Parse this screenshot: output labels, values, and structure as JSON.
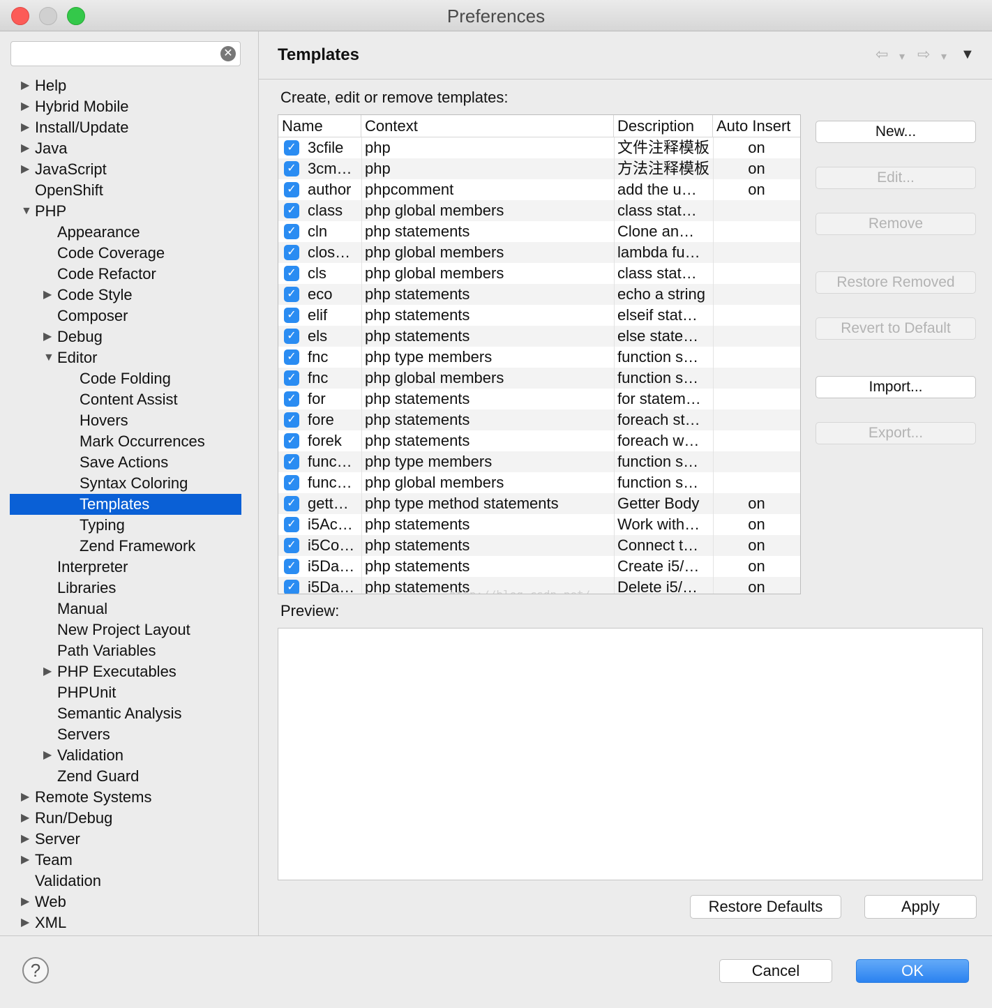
{
  "window": {
    "title": "Preferences"
  },
  "search": {
    "placeholder": "",
    "value": ""
  },
  "tree": [
    {
      "label": "Help",
      "level": 0,
      "expander": "collapsed"
    },
    {
      "label": "Hybrid Mobile",
      "level": 0,
      "expander": "collapsed"
    },
    {
      "label": "Install/Update",
      "level": 0,
      "expander": "collapsed"
    },
    {
      "label": "Java",
      "level": 0,
      "expander": "collapsed"
    },
    {
      "label": "JavaScript",
      "level": 0,
      "expander": "collapsed"
    },
    {
      "label": "OpenShift",
      "level": 0,
      "expander": "none"
    },
    {
      "label": "PHP",
      "level": 0,
      "expander": "expanded"
    },
    {
      "label": "Appearance",
      "level": 1,
      "expander": "none"
    },
    {
      "label": "Code Coverage",
      "level": 1,
      "expander": "none"
    },
    {
      "label": "Code Refactor",
      "level": 1,
      "expander": "none"
    },
    {
      "label": "Code Style",
      "level": 1,
      "expander": "collapsed"
    },
    {
      "label": "Composer",
      "level": 1,
      "expander": "none"
    },
    {
      "label": "Debug",
      "level": 1,
      "expander": "collapsed"
    },
    {
      "label": "Editor",
      "level": 1,
      "expander": "expanded"
    },
    {
      "label": "Code Folding",
      "level": 2,
      "expander": "none"
    },
    {
      "label": "Content Assist",
      "level": 2,
      "expander": "none"
    },
    {
      "label": "Hovers",
      "level": 2,
      "expander": "none"
    },
    {
      "label": "Mark Occurrences",
      "level": 2,
      "expander": "none"
    },
    {
      "label": "Save Actions",
      "level": 2,
      "expander": "none"
    },
    {
      "label": "Syntax Coloring",
      "level": 2,
      "expander": "none"
    },
    {
      "label": "Templates",
      "level": 2,
      "expander": "none",
      "selected": true
    },
    {
      "label": "Typing",
      "level": 2,
      "expander": "none"
    },
    {
      "label": "Zend Framework",
      "level": 2,
      "expander": "none"
    },
    {
      "label": "Interpreter",
      "level": 1,
      "expander": "none"
    },
    {
      "label": "Libraries",
      "level": 1,
      "expander": "none"
    },
    {
      "label": "Manual",
      "level": 1,
      "expander": "none"
    },
    {
      "label": "New Project Layout",
      "level": 1,
      "expander": "none"
    },
    {
      "label": "Path Variables",
      "level": 1,
      "expander": "none"
    },
    {
      "label": "PHP Executables",
      "level": 1,
      "expander": "collapsed"
    },
    {
      "label": "PHPUnit",
      "level": 1,
      "expander": "none"
    },
    {
      "label": "Semantic Analysis",
      "level": 1,
      "expander": "none"
    },
    {
      "label": "Servers",
      "level": 1,
      "expander": "none"
    },
    {
      "label": "Validation",
      "level": 1,
      "expander": "collapsed"
    },
    {
      "label": "Zend Guard",
      "level": 1,
      "expander": "none"
    },
    {
      "label": "Remote Systems",
      "level": 0,
      "expander": "collapsed"
    },
    {
      "label": "Run/Debug",
      "level": 0,
      "expander": "collapsed"
    },
    {
      "label": "Server",
      "level": 0,
      "expander": "collapsed"
    },
    {
      "label": "Team",
      "level": 0,
      "expander": "collapsed"
    },
    {
      "label": "Validation",
      "level": 0,
      "expander": "none"
    },
    {
      "label": "Web",
      "level": 0,
      "expander": "collapsed"
    },
    {
      "label": "XML",
      "level": 0,
      "expander": "collapsed"
    }
  ],
  "page": {
    "title": "Templates",
    "intro": "Create, edit or remove templates:",
    "preview_label": "Preview:",
    "watermark": "http://blog.csdn.net/"
  },
  "table": {
    "columns": [
      "Name",
      "Context",
      "Description",
      "Auto Insert"
    ],
    "rows": [
      {
        "name": "3cfile",
        "context": "php",
        "description": "文件注释模板",
        "auto": "on",
        "checked": true
      },
      {
        "name": "3cm…",
        "context": "php",
        "description": "方法注释模板",
        "auto": "on",
        "checked": true
      },
      {
        "name": "author",
        "context": "phpcomment",
        "description": "add the u…",
        "auto": "on",
        "checked": true
      },
      {
        "name": "class",
        "context": "php global members",
        "description": "class stat…",
        "auto": "",
        "checked": true
      },
      {
        "name": "cln",
        "context": "php statements",
        "description": "Clone an…",
        "auto": "",
        "checked": true
      },
      {
        "name": "clos…",
        "context": "php global members",
        "description": "lambda fu…",
        "auto": "",
        "checked": true
      },
      {
        "name": "cls",
        "context": "php global members",
        "description": "class stat…",
        "auto": "",
        "checked": true
      },
      {
        "name": "eco",
        "context": "php statements",
        "description": "echo a string",
        "auto": "",
        "checked": true
      },
      {
        "name": "elif",
        "context": "php statements",
        "description": "elseif stat…",
        "auto": "",
        "checked": true
      },
      {
        "name": "els",
        "context": "php statements",
        "description": "else state…",
        "auto": "",
        "checked": true
      },
      {
        "name": "fnc",
        "context": "php type members",
        "description": "function s…",
        "auto": "",
        "checked": true
      },
      {
        "name": "fnc",
        "context": "php global members",
        "description": "function s…",
        "auto": "",
        "checked": true
      },
      {
        "name": "for",
        "context": "php statements",
        "description": "for statem…",
        "auto": "",
        "checked": true
      },
      {
        "name": "fore",
        "context": "php statements",
        "description": "foreach st…",
        "auto": "",
        "checked": true
      },
      {
        "name": "forek",
        "context": "php statements",
        "description": "foreach w…",
        "auto": "",
        "checked": true
      },
      {
        "name": "func…",
        "context": "php type members",
        "description": "function s…",
        "auto": "",
        "checked": true
      },
      {
        "name": "func…",
        "context": "php global members",
        "description": "function s…",
        "auto": "",
        "checked": true
      },
      {
        "name": "gett…",
        "context": "php type method statements",
        "description": "Getter Body",
        "auto": "on",
        "checked": true
      },
      {
        "name": "i5Ac…",
        "context": "php statements",
        "description": "Work with…",
        "auto": "on",
        "checked": true
      },
      {
        "name": "i5Co…",
        "context": "php statements",
        "description": "Connect t…",
        "auto": "on",
        "checked": true
      },
      {
        "name": "i5Da…",
        "context": "php statements",
        "description": "Create i5/…",
        "auto": "on",
        "checked": true
      },
      {
        "name": "i5Da…",
        "context": "php statements",
        "description": "Delete i5/…",
        "auto": "on",
        "checked": true
      }
    ]
  },
  "side_buttons": [
    {
      "label": "New...",
      "enabled": true
    },
    {
      "label": "Edit...",
      "enabled": false
    },
    {
      "label": "Remove",
      "enabled": false
    },
    {
      "label": "Restore Removed",
      "enabled": false
    },
    {
      "label": "Revert to Default",
      "enabled": false
    },
    {
      "label": "Import...",
      "enabled": true
    },
    {
      "label": "Export...",
      "enabled": false
    }
  ],
  "bottom": {
    "restore_defaults": "Restore Defaults",
    "apply": "Apply"
  },
  "footer": {
    "help": "?",
    "cancel": "Cancel",
    "ok": "OK"
  },
  "icons": {
    "search_clear": "✕",
    "back": "⇦",
    "forward": "⇨",
    "dropdown": "▾",
    "view_menu": "▼",
    "collapsed": "▶",
    "expanded": "▼",
    "check": "✓"
  },
  "colors": {
    "selection": "#0a60d6",
    "checkbox": "#2a8cf2",
    "ok_button": "#2b82f0"
  }
}
